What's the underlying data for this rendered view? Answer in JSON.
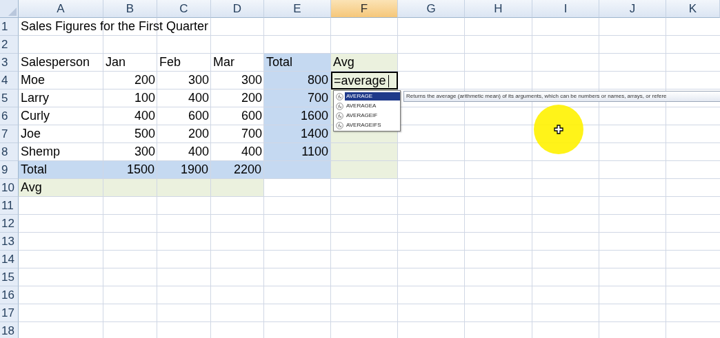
{
  "columns": [
    {
      "label": "A",
      "selected": false
    },
    {
      "label": "B",
      "selected": false
    },
    {
      "label": "C",
      "selected": false
    },
    {
      "label": "D",
      "selected": false
    },
    {
      "label": "E",
      "selected": false
    },
    {
      "label": "F",
      "selected": true
    },
    {
      "label": "G",
      "selected": false
    },
    {
      "label": "H",
      "selected": false
    },
    {
      "label": "I",
      "selected": false
    },
    {
      "label": "J",
      "selected": false
    },
    {
      "label": "K",
      "selected": false
    }
  ],
  "rows": [
    {
      "number": "1",
      "cells": [
        {
          "text": "Sales Figures for the First Quarter",
          "kind": "text"
        }
      ]
    },
    {
      "number": "2"
    },
    {
      "number": "3",
      "cells": [
        {
          "text": "Salesperson",
          "kind": "text"
        },
        {
          "text": "Jan",
          "kind": "text"
        },
        {
          "text": "Feb",
          "kind": "text"
        },
        {
          "text": "Mar",
          "kind": "text"
        },
        {
          "text": "Total",
          "kind": "text",
          "color": "#c5d9f1"
        },
        {
          "text": "Avg",
          "kind": "text",
          "color": "#ebf1de"
        }
      ]
    },
    {
      "number": "4",
      "cells": [
        {
          "text": "Moe",
          "kind": "text"
        },
        {
          "text": "200",
          "kind": "number"
        },
        {
          "text": "300",
          "kind": "number"
        },
        {
          "text": "300",
          "kind": "number"
        },
        {
          "text": "800",
          "kind": "number",
          "color": "#c5d9f1"
        },
        {
          "text": "=average",
          "kind": "text",
          "color": "#ebf1de",
          "active": true
        }
      ]
    },
    {
      "number": "5",
      "cells": [
        {
          "text": "Larry",
          "kind": "text"
        },
        {
          "text": "100",
          "kind": "number"
        },
        {
          "text": "400",
          "kind": "number"
        },
        {
          "text": "200",
          "kind": "number"
        },
        {
          "text": "700",
          "kind": "number",
          "color": "#c5d9f1"
        },
        {
          "color": "#ebf1de"
        }
      ]
    },
    {
      "number": "6",
      "cells": [
        {
          "text": "Curly",
          "kind": "text"
        },
        {
          "text": "400",
          "kind": "number"
        },
        {
          "text": "600",
          "kind": "number"
        },
        {
          "text": "600",
          "kind": "number"
        },
        {
          "text": "1600",
          "kind": "number",
          "color": "#c5d9f1"
        },
        {
          "color": "#ebf1de"
        }
      ]
    },
    {
      "number": "7",
      "cells": [
        {
          "text": "Joe",
          "kind": "text"
        },
        {
          "text": "500",
          "kind": "number"
        },
        {
          "text": "200",
          "kind": "number"
        },
        {
          "text": "700",
          "kind": "number"
        },
        {
          "text": "1400",
          "kind": "number",
          "color": "#c5d9f1"
        },
        {
          "color": "#ebf1de"
        }
      ]
    },
    {
      "number": "8",
      "cells": [
        {
          "text": "Shemp",
          "kind": "text"
        },
        {
          "text": "300",
          "kind": "number"
        },
        {
          "text": "400",
          "kind": "number"
        },
        {
          "text": "400",
          "kind": "number"
        },
        {
          "text": "1100",
          "kind": "number",
          "color": "#c5d9f1"
        },
        {
          "color": "#ebf1de"
        }
      ]
    },
    {
      "number": "9",
      "cells": [
        {
          "text": "Total",
          "kind": "text",
          "color": "#c5d9f1"
        },
        {
          "text": "1500",
          "kind": "number",
          "color": "#c5d9f1"
        },
        {
          "text": "1900",
          "kind": "number",
          "color": "#c5d9f1"
        },
        {
          "text": "2200",
          "kind": "number",
          "color": "#c5d9f1"
        },
        {
          "color": "#c5d9f1"
        },
        {
          "color": "#ebf1de"
        }
      ]
    },
    {
      "number": "10",
      "cells": [
        {
          "text": "Avg",
          "kind": "text",
          "color": "#ebf1de"
        },
        {
          "color": "#ebf1de"
        },
        {
          "color": "#ebf1de"
        },
        {
          "color": "#ebf1de"
        }
      ]
    },
    {
      "number": "11"
    },
    {
      "number": "12"
    },
    {
      "number": "13"
    },
    {
      "number": "14"
    },
    {
      "number": "15"
    },
    {
      "number": "16"
    },
    {
      "number": "17"
    },
    {
      "number": "18"
    }
  ],
  "autocomplete": {
    "items": [
      {
        "label": "AVERAGE",
        "selected": true
      },
      {
        "label": "AVERAGEA",
        "selected": false
      },
      {
        "label": "AVERAGEIF",
        "selected": false
      },
      {
        "label": "AVERAGEIFS",
        "selected": false
      }
    ],
    "tooltip": "Returns the average (arithmetic mean) of its arguments, which can be numbers or names, arrays, or refere"
  }
}
